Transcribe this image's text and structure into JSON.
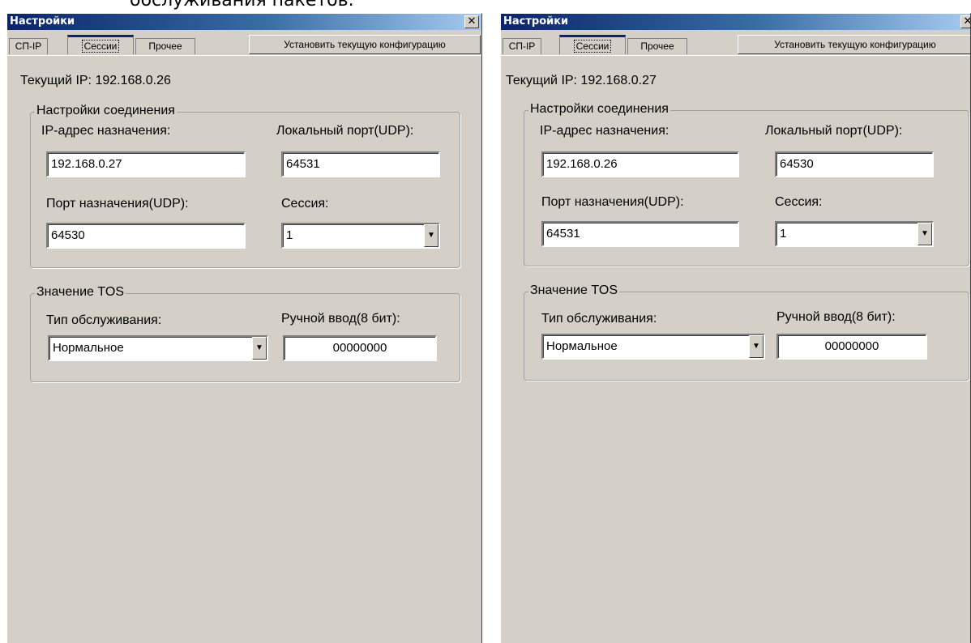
{
  "caption": "обслуживания пакетов.",
  "windows": [
    {
      "title": "Настройки",
      "close_label": "✕",
      "tabs": [
        "СП-IP",
        "Сессии",
        "Прочее"
      ],
      "apply_label": "Установить текущую конфигурацию",
      "current_ip_label": "Текущий IP: 192.168.0.26",
      "connection_group": "Настройки соединения",
      "dest_ip_label": "IP-адрес назначения:",
      "dest_ip_value": "192.168.0.27",
      "local_port_label": "Локальный порт(UDP):",
      "local_port_value": "64531",
      "dest_port_label": "Порт назначения(UDP):",
      "dest_port_value": "64530",
      "session_label": "Сессия:",
      "session_value": "1",
      "tos_group": "Значение TOS",
      "service_type_label": "Тип обслуживания:",
      "service_type_value": "Нормальное",
      "manual_label": "Ручной ввод(8 бит):",
      "manual_value": "00000000"
    },
    {
      "title": "Настройки",
      "close_label": "✕",
      "tabs": [
        "СП-IP",
        "Сессии",
        "Прочее"
      ],
      "apply_label": "Установить текущую конфигурацию",
      "current_ip_label": "Текущий IP: 192.168.0.27",
      "connection_group": "Настройки соединения",
      "dest_ip_label": "IP-адрес назначения:",
      "dest_ip_value": "192.168.0.26",
      "local_port_label": "Локальный порт(UDP):",
      "local_port_value": "64530",
      "dest_port_label": "Порт назначения(UDP):",
      "dest_port_value": "64531",
      "session_label": "Сессия:",
      "session_value": "1",
      "tos_group": "Значение TOS",
      "service_type_label": "Тип обслуживания:",
      "service_type_value": "Нормальное",
      "manual_label": "Ручной ввод(8 бит):",
      "manual_value": "00000000"
    }
  ],
  "icons": {
    "dropdown": "chevron-down-icon"
  },
  "colors": {
    "window_bg": "#d4d0c8",
    "title_start": "#0a246a",
    "title_end": "#a6caf0"
  }
}
